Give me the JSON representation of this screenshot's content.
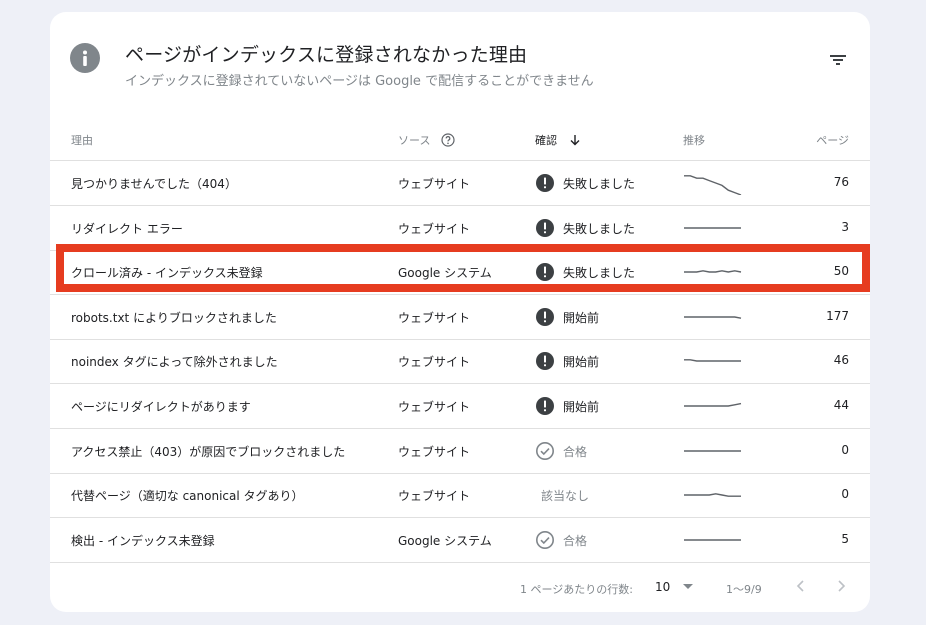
{
  "header": {
    "title": "ページがインデックスに登録されなかった理由",
    "subtitle": "インデックスに登録されていないページは Google で配信することができません",
    "icon": "info-icon",
    "filter_icon": "filter-icon"
  },
  "columns": {
    "reason": "理由",
    "source": "ソース",
    "status": "確認",
    "trend": "推移",
    "pages": "ページ"
  },
  "rows": [
    {
      "reason": "見つかりませんでした（404）",
      "source": "ウェブサイト",
      "status": "失敗しました",
      "status_type": "failed",
      "pages": "76",
      "trend": [
        2,
        2,
        3,
        3,
        4,
        5,
        6,
        8,
        9,
        10
      ]
    },
    {
      "reason": "リダイレクト エラー",
      "source": "ウェブサイト",
      "status": "失敗しました",
      "status_type": "failed",
      "pages": "3",
      "trend": [
        5,
        5,
        5,
        5,
        5,
        5,
        5,
        5,
        5,
        5
      ]
    },
    {
      "reason": "クロール済み - インデックス未登録",
      "source": "Google システム",
      "status": "失敗しました",
      "status_type": "failed",
      "pages": "50",
      "trend": [
        5,
        5,
        5,
        4.5,
        5,
        5,
        4.5,
        5,
        4.5,
        5
      ]
    },
    {
      "reason": "robots.txt によりブロックされました",
      "source": "ウェブサイト",
      "status": "開始前",
      "status_type": "not-started",
      "pages": "177",
      "trend": [
        5,
        5,
        5,
        5,
        5,
        5,
        5,
        5,
        5,
        5.5
      ]
    },
    {
      "reason": "noindex タグによって除外されました",
      "source": "ウェブサイト",
      "status": "開始前",
      "status_type": "not-started",
      "pages": "46",
      "trend": [
        4.5,
        4.5,
        5,
        5,
        5,
        5,
        5,
        5,
        5,
        5
      ]
    },
    {
      "reason": "ページにリダイレクトがあります",
      "source": "ウェブサイト",
      "status": "開始前",
      "status_type": "not-started",
      "pages": "44",
      "trend": [
        5,
        5,
        5,
        5,
        5,
        5,
        5,
        5,
        4.5,
        4
      ]
    },
    {
      "reason": "アクセス禁止（403）が原因でブロックされました",
      "source": "ウェブサイト",
      "status": "合格",
      "status_type": "passed",
      "pages": "0",
      "trend": [
        5,
        5,
        5,
        5,
        5,
        5,
        5,
        5,
        5,
        5
      ]
    },
    {
      "reason": "代替ページ（適切な canonical タグあり）",
      "source": "ウェブサイト",
      "status": "該当なし",
      "status_type": "na",
      "pages": "0",
      "trend": [
        5,
        5,
        5,
        5,
        5,
        4.5,
        5,
        5.5,
        5.5,
        5.5
      ]
    },
    {
      "reason": "検出 - インデックス未登録",
      "source": "Google システム",
      "status": "合格",
      "status_type": "passed",
      "pages": "5",
      "trend": [
        5,
        5,
        5,
        5,
        5,
        5,
        5,
        5,
        5,
        5
      ]
    }
  ],
  "highlighted_row": 2,
  "footer": {
    "rows_per_page_label": "1 ページあたりの行数:",
    "rows_per_page": "10",
    "range": "1～9/9"
  },
  "colors": {
    "highlight": "#e63c20",
    "status_icon": "#3c4043",
    "muted": "#80868b"
  }
}
